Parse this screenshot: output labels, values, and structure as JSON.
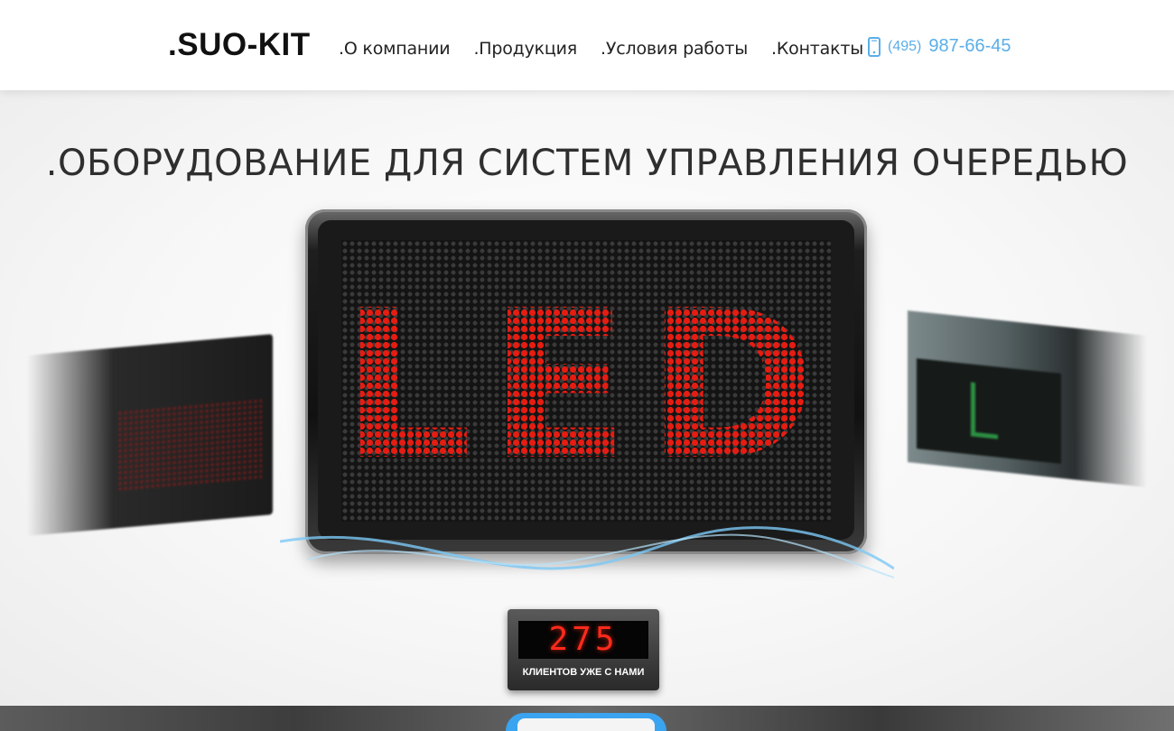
{
  "header": {
    "logo": ".SUO-KIT",
    "nav": [
      {
        "label": ".О компании"
      },
      {
        "label": ".Продукция"
      },
      {
        "label": ".Условия работы"
      },
      {
        "label": ".Контакты"
      }
    ],
    "phone": {
      "icon": "mobile-phone-icon",
      "code": "(495)",
      "number": "987-66-45"
    }
  },
  "hero": {
    "title": ".ОБОРУДОВАНИЕ ДЛЯ СИСТЕМ УПРАВЛЕНИЯ ОЧЕРЕДЬЮ",
    "board_text": "LED"
  },
  "counter": {
    "value": "275",
    "label": "КЛИЕНТОВ УЖЕ С НАМИ"
  },
  "colors": {
    "accent": "#5aaee8",
    "led_red": "#e61c12",
    "pill_blue": "#3aa4f0"
  }
}
